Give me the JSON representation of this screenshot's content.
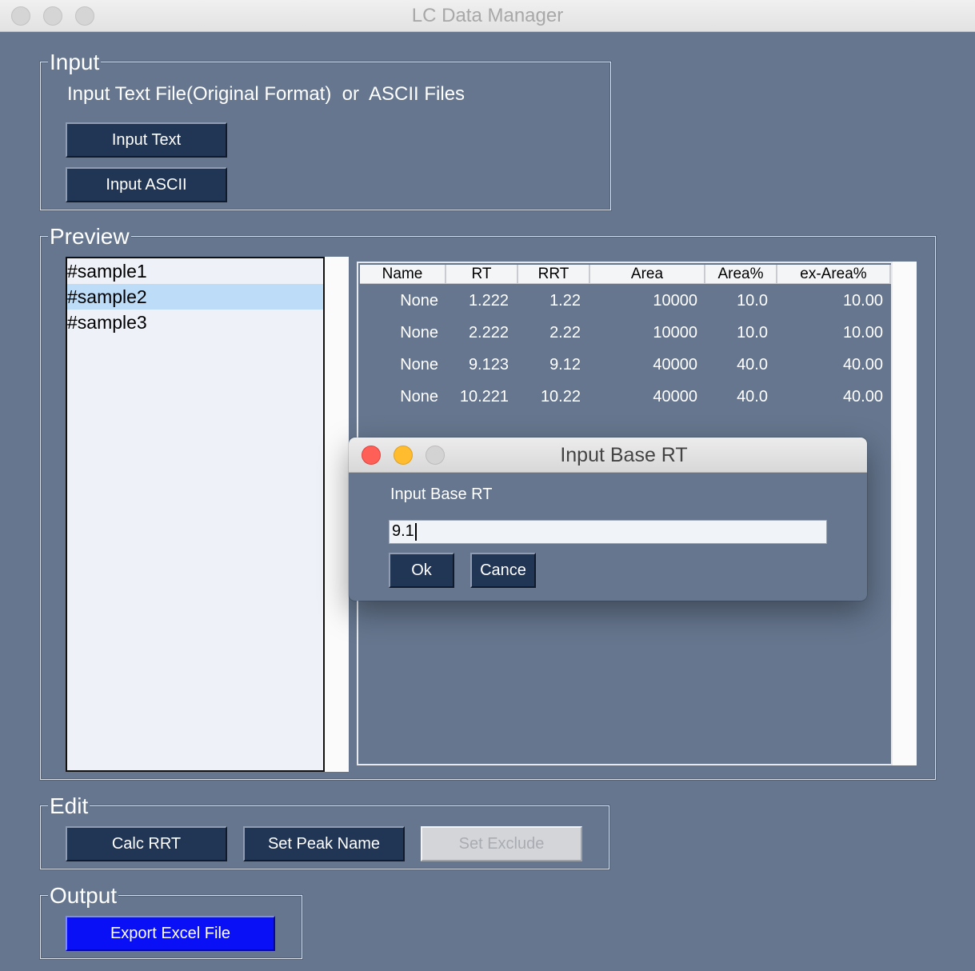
{
  "window": {
    "title": "LC Data Manager"
  },
  "input_group": {
    "legend": "Input",
    "description": "Input Text File(Original Format)  or  ASCII Files",
    "input_text_button": "Input Text",
    "input_ascii_button": "Input ASCII"
  },
  "preview_group": {
    "legend": "Preview",
    "samples": [
      "#sample1",
      "#sample2",
      "#sample3"
    ],
    "selected_sample": "#sample2",
    "table": {
      "columns": [
        "Name",
        "RT",
        "RRT",
        "Area",
        "Area%",
        "ex-Area%"
      ],
      "rows": [
        [
          "None",
          "1.222",
          "1.22",
          "10000",
          "10.0",
          "10.00"
        ],
        [
          "None",
          "2.222",
          "2.22",
          "10000",
          "10.0",
          "10.00"
        ],
        [
          "None",
          "9.123",
          "9.12",
          "40000",
          "40.0",
          "40.00"
        ],
        [
          "None",
          "10.221",
          "10.22",
          "40000",
          "40.0",
          "40.00"
        ]
      ]
    }
  },
  "edit_group": {
    "legend": "Edit",
    "calc_rrt_button": "Calc RRT",
    "set_peak_name_button": "Set Peak Name",
    "set_exclude_button": "Set Exclude"
  },
  "output_group": {
    "legend": "Output",
    "export_button": "Export Excel File"
  },
  "dialog": {
    "title": "Input Base RT",
    "label": "Input Base RT",
    "input_value": "9.1",
    "ok_button": "Ok",
    "cancel_button": "Cance"
  },
  "colors": {
    "background": "#65768e",
    "button": "#213555",
    "export_button": "#0a10f5",
    "selection": "#bcdcf8",
    "close": "#fe5f57",
    "minimize": "#febc2e"
  }
}
